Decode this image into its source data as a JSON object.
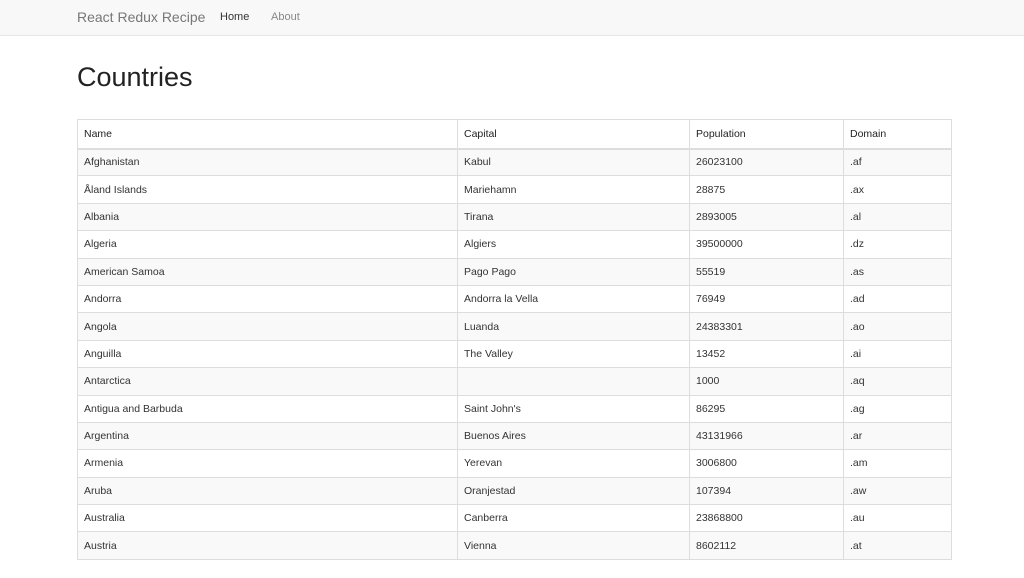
{
  "navbar": {
    "brand": "React Redux Recipe",
    "links": [
      {
        "label": "Home",
        "active": true
      },
      {
        "label": "About",
        "active": false
      }
    ]
  },
  "page": {
    "title": "Countries"
  },
  "table": {
    "columns": [
      "Name",
      "Capital",
      "Population",
      "Domain"
    ],
    "rows": [
      [
        "Afghanistan",
        "Kabul",
        "26023100",
        ".af"
      ],
      [
        "Åland Islands",
        "Mariehamn",
        "28875",
        ".ax"
      ],
      [
        "Albania",
        "Tirana",
        "2893005",
        ".al"
      ],
      [
        "Algeria",
        "Algiers",
        "39500000",
        ".dz"
      ],
      [
        "American Samoa",
        "Pago Pago",
        "55519",
        ".as"
      ],
      [
        "Andorra",
        "Andorra la Vella",
        "76949",
        ".ad"
      ],
      [
        "Angola",
        "Luanda",
        "24383301",
        ".ao"
      ],
      [
        "Anguilla",
        "The Valley",
        "13452",
        ".ai"
      ],
      [
        "Antarctica",
        "",
        "1000",
        ".aq"
      ],
      [
        "Antigua and Barbuda",
        "Saint John's",
        "86295",
        ".ag"
      ],
      [
        "Argentina",
        "Buenos Aires",
        "43131966",
        ".ar"
      ],
      [
        "Armenia",
        "Yerevan",
        "3006800",
        ".am"
      ],
      [
        "Aruba",
        "Oranjestad",
        "107394",
        ".aw"
      ],
      [
        "Australia",
        "Canberra",
        "23868800",
        ".au"
      ],
      [
        "Austria",
        "Vienna",
        "8602112",
        ".at"
      ]
    ]
  },
  "colors": {
    "navbar_bg": "#f8f8f8",
    "stripe": "#f9f9f9",
    "border": "#dddddd"
  }
}
